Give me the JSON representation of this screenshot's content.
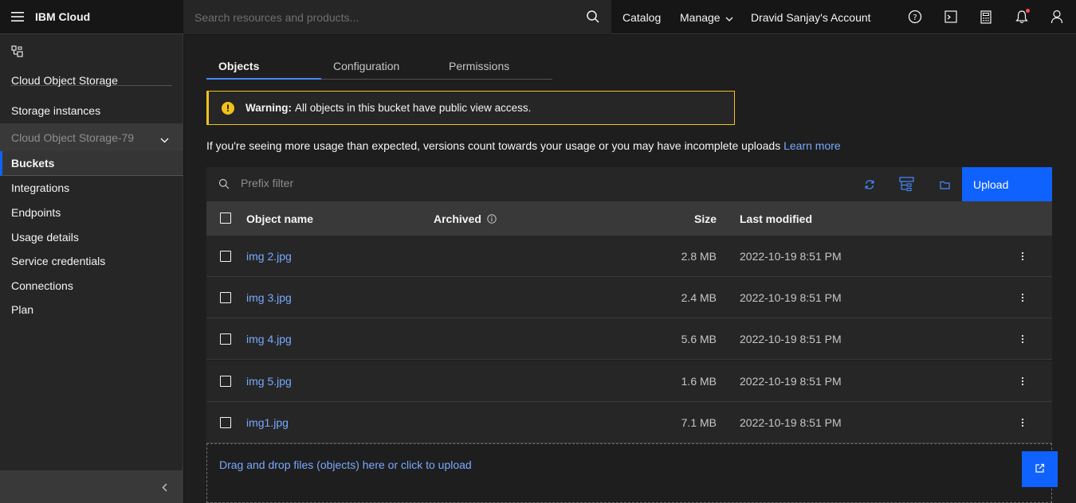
{
  "header": {
    "brand": "IBM Cloud",
    "search_placeholder": "Search resources and products...",
    "catalog": "Catalog",
    "manage": "Manage",
    "account": "Dravid Sanjay's Account"
  },
  "sidebar": {
    "service_title": "Cloud Object Storage",
    "storage_instances": "Storage instances",
    "instance_selector": "Cloud Object Storage-79",
    "items": [
      "Buckets",
      "Integrations",
      "Endpoints",
      "Usage details",
      "Service credentials",
      "Connections",
      "Plan"
    ]
  },
  "tabs": [
    "Objects",
    "Configuration",
    "Permissions"
  ],
  "warning": {
    "title": "Warning:",
    "message": "All objects in this bucket have public view access."
  },
  "usage_note": {
    "text": "If you're seeing more usage than expected, versions count towards your usage or you may have incomplete uploads",
    "link": "Learn more"
  },
  "toolbar": {
    "filter_placeholder": "Prefix filter",
    "upload_label": "Upload"
  },
  "table": {
    "headers": {
      "name": "Object name",
      "archived": "Archived",
      "size": "Size",
      "modified": "Last modified"
    },
    "rows": [
      {
        "name": "img 2.jpg",
        "size": "2.8 MB",
        "modified": "2022-10-19 8:51 PM"
      },
      {
        "name": "img 3.jpg",
        "size": "2.4 MB",
        "modified": "2022-10-19 8:51 PM"
      },
      {
        "name": "img 4.jpg",
        "size": "5.6 MB",
        "modified": "2022-10-19 8:51 PM"
      },
      {
        "name": "img 5.jpg",
        "size": "1.6 MB",
        "modified": "2022-10-19 8:51 PM"
      },
      {
        "name": "img1.jpg",
        "size": "7.1 MB",
        "modified": "2022-10-19 8:51 PM"
      }
    ]
  },
  "dropzone_text": "Drag and drop files (objects) here or click to upload",
  "colors": {
    "accent": "#0f62fe",
    "link": "#78a9ff",
    "warning": "#f1c21b"
  }
}
